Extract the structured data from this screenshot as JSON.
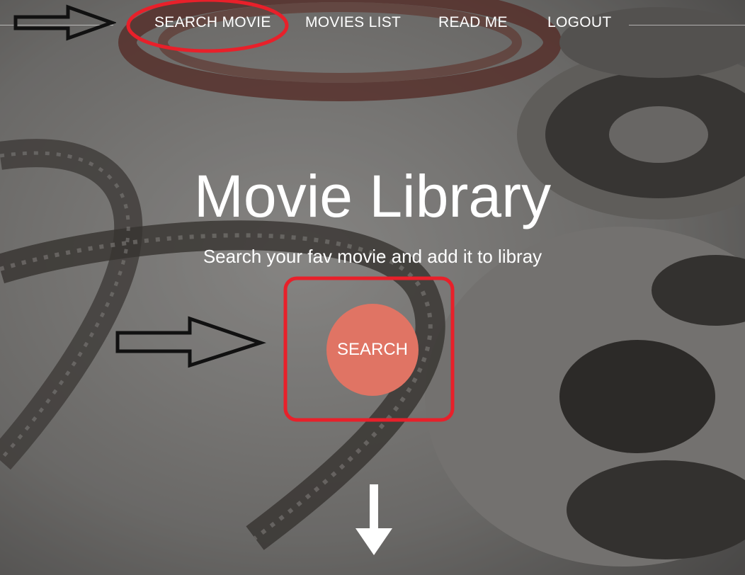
{
  "nav": {
    "items": [
      {
        "label": "SEARCH MOVIE"
      },
      {
        "label": "MOVIES LIST"
      },
      {
        "label": "READ ME"
      },
      {
        "label": "LOGOUT"
      }
    ]
  },
  "hero": {
    "title": "Movie Library",
    "subtitle": "Search your fav movie and add it to libray",
    "search_button_label": "SEARCH"
  },
  "colors": {
    "accent": "#e07464",
    "annotation_red": "#e8202a",
    "annotation_arrow": "#111111",
    "text": "#ffffff"
  },
  "icons": {
    "scroll_down": "arrow-down-icon"
  }
}
